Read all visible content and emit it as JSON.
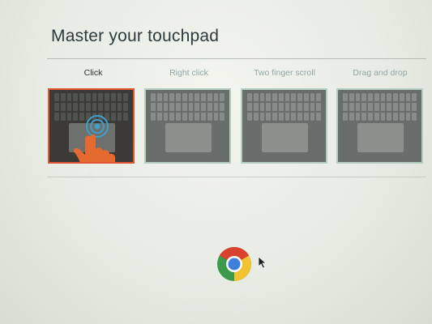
{
  "header": {
    "title": "Master your touchpad"
  },
  "tabs": [
    {
      "label": "Click",
      "active": true
    },
    {
      "label": "Right click",
      "active": false
    },
    {
      "label": "Two finger scroll",
      "active": false
    },
    {
      "label": "Drag and drop",
      "active": false
    }
  ],
  "icons": {
    "app_logo": "chrome-icon",
    "cursor": "mouse-cursor-icon",
    "gesture": "finger-tap-icon"
  },
  "colors": {
    "accent": "#e2562f",
    "inactive_tab_text": "#8fa7a6",
    "inactive_border": "#b4cfc2"
  }
}
